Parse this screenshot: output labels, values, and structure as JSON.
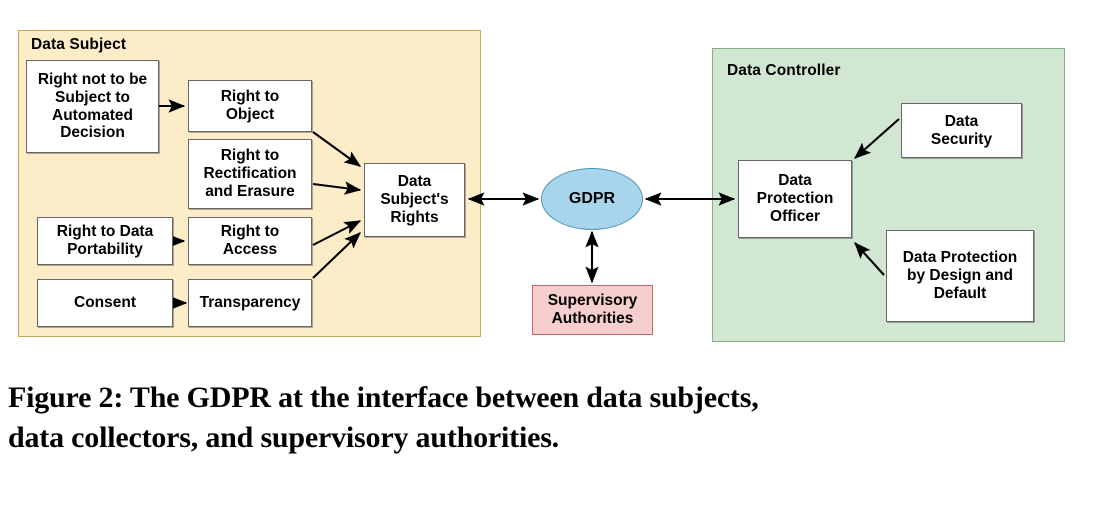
{
  "figure": {
    "caption_line1": "Figure 2: The GDPR at the interface between data subjects,",
    "caption_line2": "data collectors, and supervisory authorities."
  },
  "colors": {
    "data_subject_panel_fill": "#fcecc8",
    "data_subject_panel_border": "#c8aa4e",
    "data_controller_panel_fill": "#d1e7d1",
    "data_controller_panel_border": "#84b184",
    "gdpr_fill": "#a7d5ec",
    "gdpr_border": "#4e91b8",
    "supervisory_fill": "#f6cecd",
    "supervisory_border": "#c06a6a",
    "node_fill": "#ffffff",
    "node_border": "#666666",
    "arrow": "#000000"
  },
  "panels": {
    "data_subject": {
      "label": "Data Subject"
    },
    "data_controller": {
      "label": "Data Controller"
    }
  },
  "nodes": {
    "automated_decision": "Right not to be Subject to Automated Decision",
    "right_to_object": "Right to Object",
    "rectification_erasure": "Right to Rectification and Erasure",
    "data_portability": "Right to Data Portability",
    "right_to_access": "Right to Access",
    "consent": "Consent",
    "transparency": "Transparency",
    "data_subjects_rights": "Data Subject's Rights",
    "gdpr": "GDPR",
    "supervisory_authorities": "Supervisory Authorities",
    "data_protection_officer": "Data Protection Officer",
    "data_security": "Data Security",
    "data_protection_by_design": "Data Protection by Design and Default"
  },
  "node_lines": {
    "automated_decision": [
      "Right not to be",
      "Subject to",
      "Automated",
      "Decision"
    ],
    "right_to_object": [
      "Right to",
      "Object"
    ],
    "rectification_erasure": [
      "Right to",
      "Rectification",
      "and Erasure"
    ],
    "data_portability": [
      "Right to Data",
      "Portability"
    ],
    "right_to_access": [
      "Right to",
      "Access"
    ],
    "consent": [
      "Consent"
    ],
    "transparency": [
      "Transparency"
    ],
    "data_subjects_rights": [
      "Data",
      "Subject's",
      "Rights"
    ],
    "gdpr": [
      "GDPR"
    ],
    "supervisory_authorities": [
      "Supervisory",
      "Authorities"
    ],
    "data_protection_officer": [
      "Data",
      "Protection",
      "Officer"
    ],
    "data_security": [
      "Data",
      "Security"
    ],
    "data_protection_by_design": [
      "Data Protection",
      "by Design and",
      "Default"
    ]
  },
  "edges": [
    {
      "from": "automated_decision",
      "to": "right_to_object",
      "style": "single"
    },
    {
      "from": "right_to_object",
      "to": "data_subjects_rights",
      "style": "single"
    },
    {
      "from": "rectification_erasure",
      "to": "data_subjects_rights",
      "style": "single"
    },
    {
      "from": "data_portability",
      "to": "right_to_access",
      "style": "single"
    },
    {
      "from": "right_to_access",
      "to": "data_subjects_rights",
      "style": "single"
    },
    {
      "from": "consent",
      "to": "transparency",
      "style": "single"
    },
    {
      "from": "transparency",
      "to": "data_subjects_rights",
      "style": "single"
    },
    {
      "from": "data_subjects_rights",
      "to": "gdpr",
      "style": "double"
    },
    {
      "from": "gdpr",
      "to": "data_protection_officer",
      "style": "double"
    },
    {
      "from": "gdpr",
      "to": "supervisory_authorities",
      "style": "double"
    },
    {
      "from": "data_security",
      "to": "data_protection_officer",
      "style": "single"
    },
    {
      "from": "data_protection_by_design",
      "to": "data_protection_officer",
      "style": "single"
    }
  ]
}
